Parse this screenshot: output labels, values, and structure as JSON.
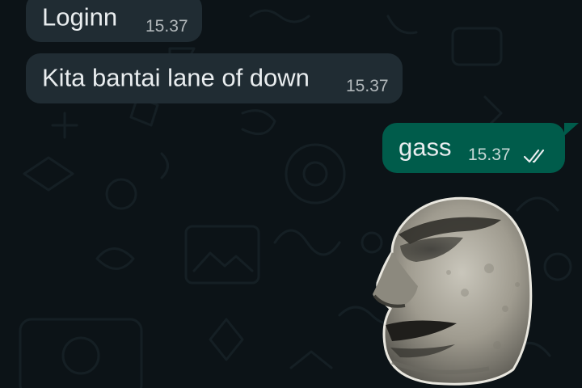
{
  "messages": [
    {
      "direction": "incoming",
      "text": "Loginn",
      "time": "15.37"
    },
    {
      "direction": "incoming",
      "text": "Kita bantai lane of down",
      "time": "15.37"
    },
    {
      "direction": "outgoing",
      "text": "gass",
      "time": "15.37",
      "status": "read"
    }
  ],
  "sticker": {
    "icon": "moai-face-sticker"
  },
  "colors": {
    "background": "#0c1317",
    "incoming_bubble": "#202c33",
    "outgoing_bubble": "#005c4b",
    "text": "#e9edef",
    "read_ticks": "#e9edef"
  },
  "icons": [
    "double-check-icon",
    "chat-doodle-wallpaper"
  ]
}
